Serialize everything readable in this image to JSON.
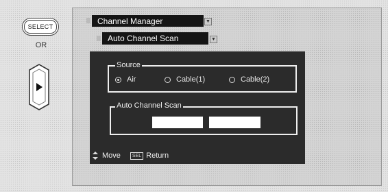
{
  "remote": {
    "select_label": "SELECT",
    "or_label": "OR",
    "right_key_icon": "right-arrow-icon"
  },
  "menu": {
    "title": "Channel Manager",
    "subtitle": "Auto Channel Scan"
  },
  "source": {
    "legend": "Source",
    "options": [
      "Air",
      "Cable(1)",
      "Cable(2)"
    ],
    "selected": "Air"
  },
  "scan": {
    "legend": "Auto Channel Scan"
  },
  "help": {
    "move_label": "Move",
    "sel_key": "SEL",
    "return_label": "Return"
  },
  "colors": {
    "panel": "#2b2b2b",
    "title_tab": "#151515"
  }
}
